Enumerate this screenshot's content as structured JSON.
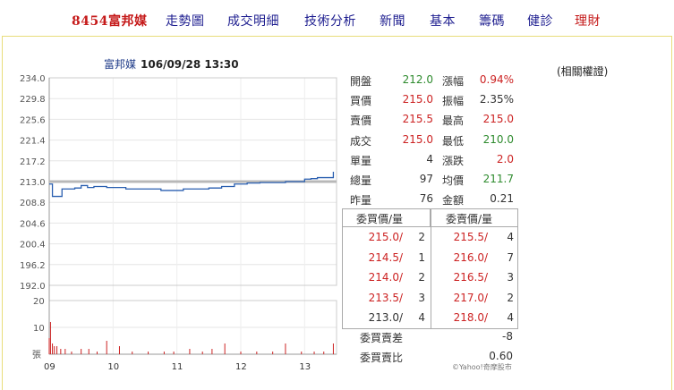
{
  "nav": {
    "title": "8454富邦媒",
    "items": [
      "走勢圖",
      "成交明細",
      "技術分析",
      "新聞",
      "基本",
      "籌碼",
      "健診",
      "理財"
    ]
  },
  "chart_header": {
    "name": "富邦媒",
    "datetime": "106/09/28 13:30"
  },
  "related_link": "(相關權證)",
  "credit": "©Yahoo!奇摩股市",
  "quote": [
    {
      "k1": "開盤",
      "v1": "212.0",
      "c1": "green",
      "k2": "漲幅",
      "v2": "0.94%",
      "c2": "red"
    },
    {
      "k1": "買價",
      "v1": "215.0",
      "c1": "red",
      "k2": "振幅",
      "v2": "2.35%",
      "c2": "black"
    },
    {
      "k1": "賣價",
      "v1": "215.5",
      "c1": "red",
      "k2": "最高",
      "v2": "215.0",
      "c2": "red"
    },
    {
      "k1": "成交",
      "v1": "215.0",
      "c1": "red",
      "k2": "最低",
      "v2": "210.0",
      "c2": "green"
    },
    {
      "k1": "單量",
      "v1": "4",
      "c1": "black",
      "k2": "漲跌",
      "v2": "2.0",
      "c2": "red"
    },
    {
      "k1": "總量",
      "v1": "97",
      "c1": "black",
      "k2": "均價",
      "v2": "211.7",
      "c2": "green"
    },
    {
      "k1": "昨量",
      "v1": "76",
      "c1": "black",
      "k2": "金額",
      "v2": "0.21",
      "c2": "black"
    }
  ],
  "order_book": {
    "bid_header": "委買價/量",
    "ask_header": "委賣價/量",
    "bids": [
      {
        "price": "215.0/",
        "qty": "2",
        "color": "red"
      },
      {
        "price": "214.5/",
        "qty": "1",
        "color": "red"
      },
      {
        "price": "214.0/",
        "qty": "2",
        "color": "red"
      },
      {
        "price": "213.5/",
        "qty": "3",
        "color": "red"
      },
      {
        "price": "213.0/",
        "qty": "4",
        "color": "black"
      }
    ],
    "asks": [
      {
        "price": "215.5/",
        "qty": "4",
        "color": "red"
      },
      {
        "price": "216.0/",
        "qty": "7",
        "color": "red"
      },
      {
        "price": "216.5/",
        "qty": "3",
        "color": "red"
      },
      {
        "price": "217.0/",
        "qty": "2",
        "color": "red"
      },
      {
        "price": "218.0/",
        "qty": "4",
        "color": "red"
      }
    ],
    "diff_label": "委買賣差",
    "diff_value": "-8",
    "ratio_label": "委買賣比",
    "ratio_value": "0.60"
  },
  "chart_data": {
    "type": "line",
    "title": "",
    "price_ticks": [
      "234.0",
      "229.8",
      "225.6",
      "221.4",
      "217.2",
      "213.0",
      "208.8",
      "204.6",
      "200.4",
      "196.2",
      "192.0"
    ],
    "price_ylim": [
      192.0,
      234.0
    ],
    "reference_price": 213.0,
    "volume_ticks": [
      "20",
      "10",
      "張"
    ],
    "volume_ylim": [
      0,
      20
    ],
    "x_ticks": [
      "09",
      "10",
      "11",
      "12",
      "13"
    ],
    "xlim": [
      9.0,
      13.5
    ],
    "price_series": {
      "name": "",
      "x": [
        9.0,
        9.05,
        9.12,
        9.2,
        9.3,
        9.4,
        9.5,
        9.6,
        9.7,
        9.8,
        9.9,
        10.0,
        10.2,
        10.4,
        10.6,
        10.75,
        10.9,
        11.1,
        11.3,
        11.5,
        11.7,
        11.9,
        12.1,
        12.3,
        12.5,
        12.7,
        12.9,
        13.0,
        13.1,
        13.2,
        13.3,
        13.4,
        13.45
      ],
      "y": [
        212.5,
        210.0,
        210.0,
        211.5,
        211.5,
        211.7,
        212.2,
        211.8,
        212.0,
        212.0,
        211.8,
        211.8,
        211.5,
        211.5,
        211.5,
        211.2,
        211.2,
        211.5,
        211.5,
        211.7,
        212.0,
        212.5,
        212.7,
        212.8,
        212.8,
        213.0,
        213.0,
        213.5,
        213.6,
        213.8,
        213.8,
        213.8,
        215.0
      ]
    },
    "volume_series": {
      "name": "",
      "x": [
        9.0,
        9.02,
        9.05,
        9.08,
        9.12,
        9.18,
        9.25,
        9.35,
        9.5,
        9.62,
        9.75,
        9.9,
        10.1,
        10.3,
        10.55,
        10.8,
        10.95,
        11.2,
        11.4,
        11.55,
        11.75,
        12.0,
        12.25,
        12.5,
        12.7,
        12.95,
        13.15,
        13.3,
        13.45
      ],
      "y": [
        6,
        12,
        4,
        3,
        3,
        2,
        2,
        1,
        2,
        2,
        1,
        5,
        3,
        1,
        1,
        1,
        1,
        2,
        1,
        2,
        4,
        1,
        1,
        1,
        4,
        1,
        1,
        1,
        4
      ]
    }
  }
}
